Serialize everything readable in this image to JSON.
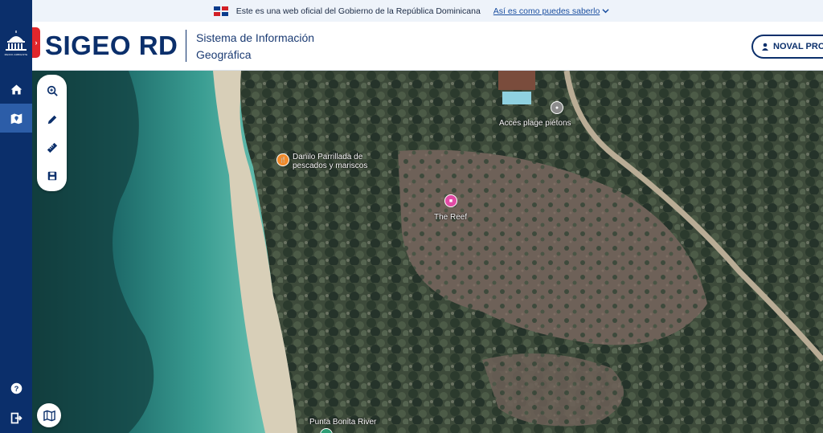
{
  "gov_banner": {
    "text": "Este es una web oficial del Gobierno de la República Dominicana",
    "link": "Así es como puedes saberlo"
  },
  "sidebar": {
    "logo_text": "MEDIO AMBIENTE",
    "items": [
      {
        "name": "home",
        "icon": "home-icon"
      },
      {
        "name": "map",
        "icon": "map-icon",
        "active": true
      },
      {
        "name": "help",
        "icon": "help-icon"
      },
      {
        "name": "logout",
        "icon": "logout-icon"
      }
    ]
  },
  "header": {
    "brand": "SIGEO RD",
    "subtitle_line1": "Sistema de Información",
    "subtitle_line2": "Geográfica",
    "user_label": "NOVAL PROP"
  },
  "map_tools": [
    {
      "name": "zoom",
      "icon": "zoom-icon"
    },
    {
      "name": "draw",
      "icon": "pencil-icon"
    },
    {
      "name": "measure",
      "icon": "ruler-icon"
    },
    {
      "name": "save",
      "icon": "save-icon"
    }
  ],
  "pois": {
    "acces": "Acces plage piétons",
    "danilo_line1": "Danilo Parrillada de",
    "danilo_line2": "pescados y mariscos",
    "reef": "The Reef",
    "punta": "Punta Bonita River"
  },
  "colors": {
    "primary": "#0b2f6b",
    "accent_red": "#e0262b",
    "active": "#2c5da8"
  }
}
